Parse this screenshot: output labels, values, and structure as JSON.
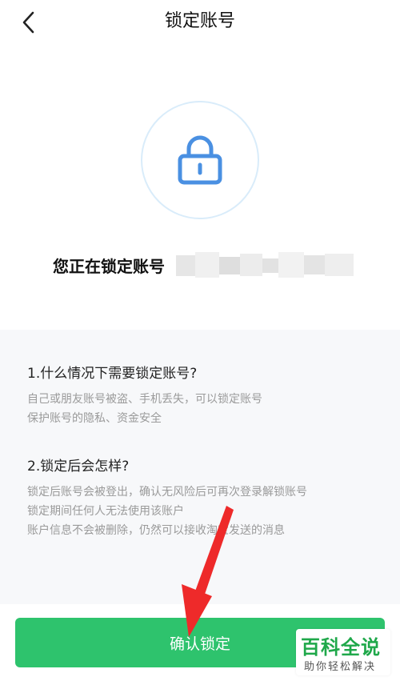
{
  "header": {
    "title": "锁定账号",
    "back_icon": "chevron-left-icon"
  },
  "hero": {
    "lock_icon": "lock-icon",
    "account_label": "您正在锁定账号",
    "icon_color": "#4a90e2"
  },
  "info": {
    "sections": [
      {
        "title": "1.什么情况下需要锁定账号?",
        "lines": [
          "自己或朋友账号被盗、手机丢失，可以锁定账号",
          "保护账号的隐私、资金安全"
        ]
      },
      {
        "title": "2.锁定后会怎样?",
        "lines": [
          "锁定后账号会被登出，确认无风险后可再次登录解锁账号",
          "锁定期间任何人无法使用该账户",
          "账户信息不会被删除，仍然可以接收淘宝发送的消息"
        ]
      }
    ]
  },
  "footer": {
    "confirm_label": "确认锁定",
    "button_color": "#2ec36d"
  },
  "watermark": {
    "main": "百科全说",
    "sub": "助你轻松解决"
  }
}
